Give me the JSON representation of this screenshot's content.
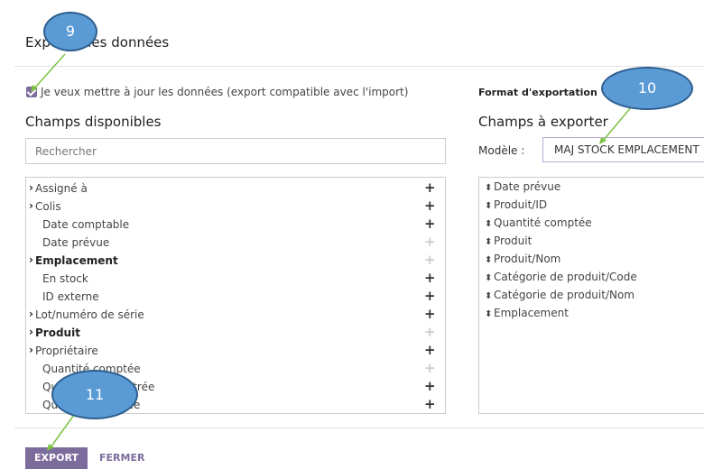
{
  "dialog": {
    "title": "Exporter les données",
    "compat_checkbox_label": "Je veux mettre à jour les données (export compatible avec l'import)",
    "compat_checked": true,
    "format_label": "Format d'exportation"
  },
  "available": {
    "heading": "Champs disponibles",
    "search_placeholder": "Rechercher",
    "items": [
      {
        "label": "Assigné à",
        "expandable": true,
        "bold": false,
        "addable": true
      },
      {
        "label": "Colis",
        "expandable": true,
        "bold": false,
        "addable": true
      },
      {
        "label": "Date comptable",
        "expandable": false,
        "bold": false,
        "addable": true
      },
      {
        "label": "Date prévue",
        "expandable": false,
        "bold": false,
        "addable": false
      },
      {
        "label": "Emplacement",
        "expandable": true,
        "bold": true,
        "addable": false
      },
      {
        "label": "En stock",
        "expandable": false,
        "bold": false,
        "addable": true
      },
      {
        "label": "ID externe",
        "expandable": false,
        "bold": false,
        "addable": true
      },
      {
        "label": "Lot/numéro de série",
        "expandable": true,
        "bold": false,
        "addable": true
      },
      {
        "label": "Produit",
        "expandable": true,
        "bold": true,
        "addable": false
      },
      {
        "label": "Propriétaire",
        "expandable": true,
        "bold": false,
        "addable": true
      },
      {
        "label": "Quantité comptée",
        "expandable": false,
        "bold": false,
        "addable": false
      },
      {
        "label": "Quantité enregistrée",
        "expandable": false,
        "bold": false,
        "addable": true
      },
      {
        "label": "Quantité réservée",
        "expandable": false,
        "bold": false,
        "addable": true
      }
    ]
  },
  "export": {
    "heading": "Champs à exporter",
    "model_label": "Modèle :",
    "model_value": "MAJ STOCK EMPLACEMENT",
    "fields": [
      "Date prévue",
      "Produit/ID",
      "Quantité comptée",
      "Produit",
      "Produit/Nom",
      "Catégorie de produit/Code",
      "Catégorie de produit/Nom",
      "Emplacement"
    ]
  },
  "buttons": {
    "export": "EXPORT",
    "close": "FERMER"
  },
  "callouts": [
    "9",
    "10",
    "11"
  ],
  "colors": {
    "accent": "#7c6c9c",
    "callout": "#5b9bd5",
    "arrow": "#7dc242"
  }
}
